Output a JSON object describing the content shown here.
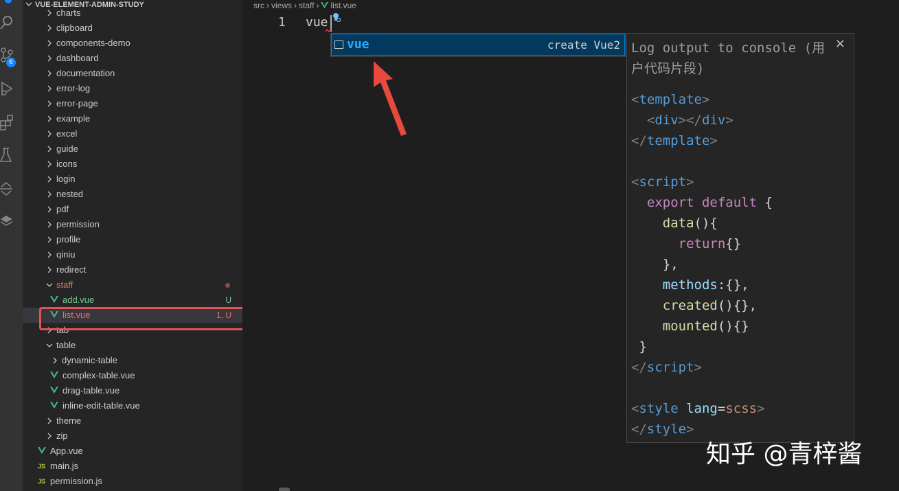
{
  "explorer": {
    "title": "VUE-ELEMENT-ADMIN-STUDY",
    "items": [
      {
        "label": "charts",
        "kind": "folder",
        "expanded": false
      },
      {
        "label": "clipboard",
        "kind": "folder",
        "expanded": false
      },
      {
        "label": "components-demo",
        "kind": "folder",
        "expanded": false
      },
      {
        "label": "dashboard",
        "kind": "folder",
        "expanded": false
      },
      {
        "label": "documentation",
        "kind": "folder",
        "expanded": false
      },
      {
        "label": "error-log",
        "kind": "folder",
        "expanded": false
      },
      {
        "label": "error-page",
        "kind": "folder",
        "expanded": false
      },
      {
        "label": "example",
        "kind": "folder",
        "expanded": false
      },
      {
        "label": "excel",
        "kind": "folder",
        "expanded": false
      },
      {
        "label": "guide",
        "kind": "folder",
        "expanded": false
      },
      {
        "label": "icons",
        "kind": "folder",
        "expanded": false
      },
      {
        "label": "login",
        "kind": "folder",
        "expanded": false
      },
      {
        "label": "nested",
        "kind": "folder",
        "expanded": false
      },
      {
        "label": "pdf",
        "kind": "folder",
        "expanded": false
      },
      {
        "label": "permission",
        "kind": "folder",
        "expanded": false
      },
      {
        "label": "profile",
        "kind": "folder",
        "expanded": false
      },
      {
        "label": "qiniu",
        "kind": "folder",
        "expanded": false
      },
      {
        "label": "redirect",
        "kind": "folder",
        "expanded": false
      },
      {
        "label": "staff",
        "kind": "folder",
        "expanded": true
      },
      {
        "label": "add.vue",
        "kind": "vue",
        "status": "U"
      },
      {
        "label": "list.vue",
        "kind": "vue",
        "status": "1, U"
      },
      {
        "label": "tab",
        "kind": "folder",
        "expanded": false
      },
      {
        "label": "table",
        "kind": "folder",
        "expanded": true
      },
      {
        "label": "dynamic-table",
        "kind": "folder",
        "expanded": false
      },
      {
        "label": "complex-table.vue",
        "kind": "vue"
      },
      {
        "label": "drag-table.vue",
        "kind": "vue"
      },
      {
        "label": "inline-edit-table.vue",
        "kind": "vue"
      },
      {
        "label": "theme",
        "kind": "folder",
        "expanded": false
      },
      {
        "label": "zip",
        "kind": "folder",
        "expanded": false
      },
      {
        "label": "App.vue",
        "kind": "vue"
      },
      {
        "label": "main.js",
        "kind": "js"
      },
      {
        "label": "permission.js",
        "kind": "js"
      }
    ]
  },
  "activity_badge": "6",
  "icons": {
    "explorer": "files-icon",
    "search": "search-icon",
    "scm": "source-control-icon",
    "debug": "run-debug-icon",
    "extensions": "extensions-icon",
    "testing": "beaker-icon",
    "remote": "remote-icon",
    "layers": "layers-icon",
    "js_badge": "JS"
  },
  "breadcrumb": {
    "parts": [
      "src",
      "views",
      "staff"
    ],
    "file": "list.vue"
  },
  "editor": {
    "line_number": "1",
    "code": "vue"
  },
  "suggest": {
    "label": "vue",
    "detail": "create Vue2"
  },
  "details": {
    "title": "Log output to console (用户代码片段)",
    "close": "×",
    "code_lines": [
      [
        {
          "t": "<",
          "c": "punct"
        },
        {
          "t": "template",
          "c": "tag"
        },
        {
          "t": ">",
          "c": "punct"
        }
      ],
      [
        {
          "t": "  ",
          "c": "plain"
        },
        {
          "t": "<",
          "c": "punct"
        },
        {
          "t": "div",
          "c": "tag"
        },
        {
          "t": "></",
          "c": "punct"
        },
        {
          "t": "div",
          "c": "tag"
        },
        {
          "t": ">",
          "c": "punct"
        }
      ],
      [
        {
          "t": "</",
          "c": "punct"
        },
        {
          "t": "template",
          "c": "tag"
        },
        {
          "t": ">",
          "c": "punct"
        }
      ],
      [
        {
          "t": "",
          "c": "plain"
        }
      ],
      [
        {
          "t": "<",
          "c": "punct"
        },
        {
          "t": "script",
          "c": "tag"
        },
        {
          "t": ">",
          "c": "punct"
        }
      ],
      [
        {
          "t": "  ",
          "c": "plain"
        },
        {
          "t": "export default",
          "c": "keyword"
        },
        {
          "t": " {",
          "c": "plain"
        }
      ],
      [
        {
          "t": "    ",
          "c": "plain"
        },
        {
          "t": "data",
          "c": "fn"
        },
        {
          "t": "(){",
          "c": "plain"
        }
      ],
      [
        {
          "t": "      ",
          "c": "plain"
        },
        {
          "t": "return",
          "c": "keyword"
        },
        {
          "t": "{}",
          "c": "plain"
        }
      ],
      [
        {
          "t": "    },",
          "c": "plain"
        }
      ],
      [
        {
          "t": "    ",
          "c": "plain"
        },
        {
          "t": "methods",
          "c": "prop"
        },
        {
          "t": ":{},",
          "c": "plain"
        }
      ],
      [
        {
          "t": "    ",
          "c": "plain"
        },
        {
          "t": "created",
          "c": "fn"
        },
        {
          "t": "(){},",
          "c": "plain"
        }
      ],
      [
        {
          "t": "    ",
          "c": "plain"
        },
        {
          "t": "mounted",
          "c": "fn"
        },
        {
          "t": "(){}",
          "c": "plain"
        }
      ],
      [
        {
          "t": " }",
          "c": "plain"
        }
      ],
      [
        {
          "t": "</",
          "c": "punct"
        },
        {
          "t": "script",
          "c": "tag"
        },
        {
          "t": ">",
          "c": "punct"
        }
      ],
      [
        {
          "t": "",
          "c": "plain"
        }
      ],
      [
        {
          "t": "<",
          "c": "punct"
        },
        {
          "t": "style",
          "c": "tag"
        },
        {
          "t": " ",
          "c": "plain"
        },
        {
          "t": "lang",
          "c": "attr"
        },
        {
          "t": "=",
          "c": "plain"
        },
        {
          "t": "scss",
          "c": "str"
        },
        {
          "t": ">",
          "c": "punct"
        }
      ],
      [
        {
          "t": "</",
          "c": "punct"
        },
        {
          "t": "style",
          "c": "tag"
        },
        {
          "t": ">",
          "c": "punct"
        }
      ]
    ]
  },
  "watermark": "知乎 @青梓酱",
  "colors": {
    "vue_green": "#41b883",
    "modified_red": "#e2735f",
    "untracked_green": "#73c991",
    "annotation_red": "#e05454",
    "suggest_blue": "#2aaaff"
  }
}
